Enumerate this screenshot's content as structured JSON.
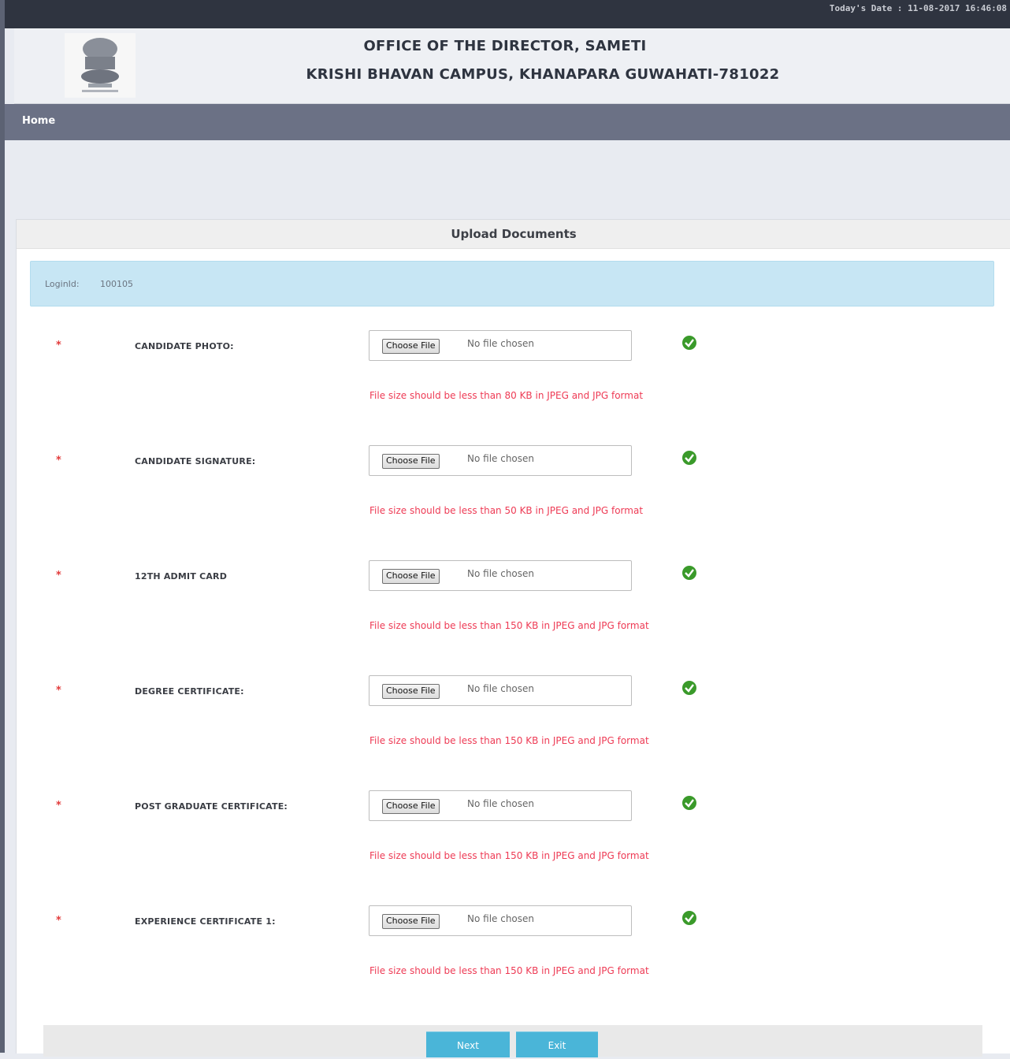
{
  "topbar": {
    "date_text": "Today's Date : 11-08-2017 16:46:08"
  },
  "header": {
    "line1": "OFFICE OF THE DIRECTOR, SAMETI",
    "line2": "KRISHI BHAVAN CAMPUS, KHANAPARA GUWAHATI-781022"
  },
  "nav": {
    "home": "Home"
  },
  "panel": {
    "title": "Upload Documents"
  },
  "login": {
    "label": "LoginId:",
    "value": "100105"
  },
  "fields": [
    {
      "label": "CANDIDATE PHOTO:",
      "button": "Choose File",
      "status": "No file chosen",
      "hint": "File size should be less than 80 KB in JPEG and JPG format"
    },
    {
      "label": "CANDIDATE SIGNATURE:",
      "button": "Choose File",
      "status": "No file chosen",
      "hint": "File size should be less than 50 KB in JPEG and JPG format"
    },
    {
      "label": "12TH ADMIT CARD",
      "button": "Choose File",
      "status": "No file chosen",
      "hint": "File size should be less than 150 KB in JPEG and JPG format"
    },
    {
      "label": "DEGREE CERTIFICATE:",
      "button": "Choose File",
      "status": "No file chosen",
      "hint": "File size should be less than 150 KB in JPEG and JPG format"
    },
    {
      "label": "POST GRADUATE CERTIFICATE:",
      "button": "Choose File",
      "status": "No file chosen",
      "hint": "File size should be less than 150 KB in JPEG and JPG format"
    },
    {
      "label": "EXPERIENCE CERTIFICATE 1:",
      "button": "Choose File",
      "status": "No file chosen",
      "hint": "File size should be less than 150 KB in JPEG and JPG format"
    }
  ],
  "required_mark": "*",
  "actions": {
    "next": "Next",
    "exit": "Exit"
  },
  "colors": {
    "accent": "#4ab5d8",
    "error": "#ee3b55",
    "nav": "#6b7185",
    "ok": "#3a9a2a"
  },
  "icons": {
    "status": "check-circle-icon",
    "emblem": "government-emblem"
  }
}
